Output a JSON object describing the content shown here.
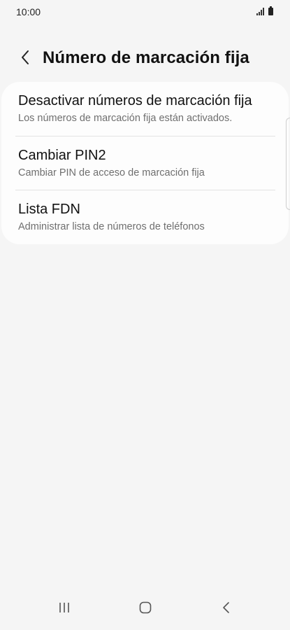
{
  "status_bar": {
    "time": "10:00",
    "signal_icon": "signal-icon",
    "battery_icon": "battery-icon"
  },
  "header": {
    "back_icon": "chevron-left-icon",
    "title": "Número de marcación fija"
  },
  "settings": {
    "items": [
      {
        "title": "Desactivar números de marcación fija",
        "subtitle": "Los números de marcación fija están activados."
      },
      {
        "title": "Cambiar PIN2",
        "subtitle": "Cambiar PIN de acceso de marcación fija"
      },
      {
        "title": "Lista FDN",
        "subtitle": "Administrar lista de números de teléfonos"
      }
    ]
  },
  "nav_bar": {
    "recents_icon": "recents-icon",
    "home_icon": "home-icon",
    "back_icon": "back-icon"
  },
  "colors": {
    "background": "#f5f5f5",
    "card": "#fdfdfd",
    "title_text": "#111111",
    "subtitle_text": "#6f6f6f"
  }
}
